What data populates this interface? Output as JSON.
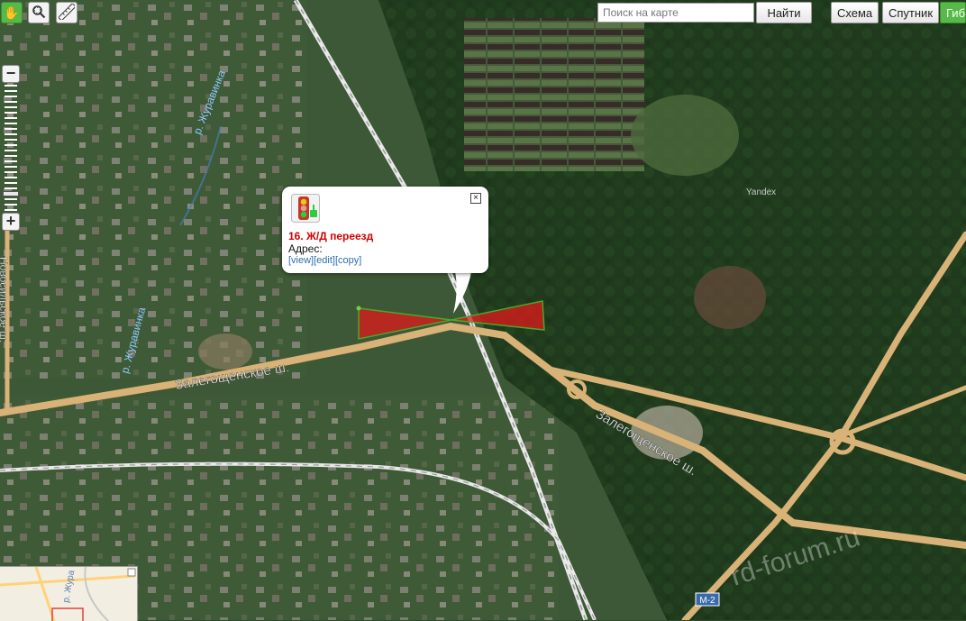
{
  "toolbar": {
    "pan_icon": "hand-icon",
    "zoom_box_icon": "magnifier-zoom-icon",
    "ruler_icon": "ruler-icon"
  },
  "search": {
    "placeholder": "Поиск на карте",
    "button_label": "Найти"
  },
  "layers": {
    "scheme_label": "Схема",
    "satellite_label": "Спутник",
    "hybrid_label": "Гибрид",
    "active": "hybrid",
    "active_color": "#57b947"
  },
  "zoom": {
    "minus": "−",
    "plus": "+",
    "level_fraction": 0.13
  },
  "popup": {
    "icon": "traffic-light-icon",
    "title": "16. Ж/Д переезд",
    "address_label": "Адрес:",
    "links": [
      "[view]",
      "[edit]",
      "[copy]"
    ],
    "close": "×"
  },
  "map_labels": {
    "river_top": "р. Журавинка",
    "river_bottom": "р. Журавинка",
    "road_left": "Залегощенское ш.",
    "road_right": "Залегощенское ш.",
    "street_vertical": "Новосильское ш.",
    "highway_badge": "М-2",
    "watermark": "rd-forum.ru",
    "provider": "Yandex",
    "minimap_label": "р. Жура"
  },
  "colors": {
    "road": "#d9b277",
    "sector_fill": "#e01a1a",
    "sector_edge": "#4aa82a",
    "title_red": "#d10000",
    "link_blue": "#2a6fb0"
  }
}
